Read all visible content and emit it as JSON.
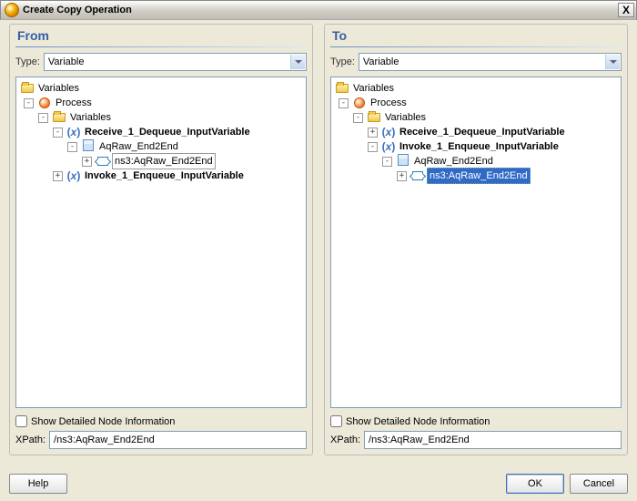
{
  "window": {
    "title": "Create Copy Operation",
    "close": "X"
  },
  "panels": {
    "from": {
      "header": "From",
      "type_label": "Type:",
      "type_value": "Variable",
      "show_detail_label": "Show Detailed Node Information",
      "xpath_label": "XPath:",
      "xpath_value": "/ns3:AqRaw_End2End",
      "tree": {
        "root": "Variables",
        "process": "Process",
        "vars": "Variables",
        "recv": "Receive_1_Dequeue_InputVariable",
        "aqraw": "AqRaw_End2End",
        "ns3": "ns3:AqRaw_End2End",
        "invoke": "Invoke_1_Enqueue_InputVariable"
      }
    },
    "to": {
      "header": "To",
      "type_label": "Type:",
      "type_value": "Variable",
      "show_detail_label": "Show Detailed Node Information",
      "xpath_label": "XPath:",
      "xpath_value": "/ns3:AqRaw_End2End",
      "tree": {
        "root": "Variables",
        "process": "Process",
        "vars": "Variables",
        "recv": "Receive_1_Dequeue_InputVariable",
        "invoke": "Invoke_1_Enqueue_InputVariable",
        "aqraw": "AqRaw_End2End",
        "ns3": "ns3:AqRaw_End2End"
      }
    }
  },
  "buttons": {
    "help": "Help",
    "ok": "OK",
    "cancel": "Cancel"
  }
}
